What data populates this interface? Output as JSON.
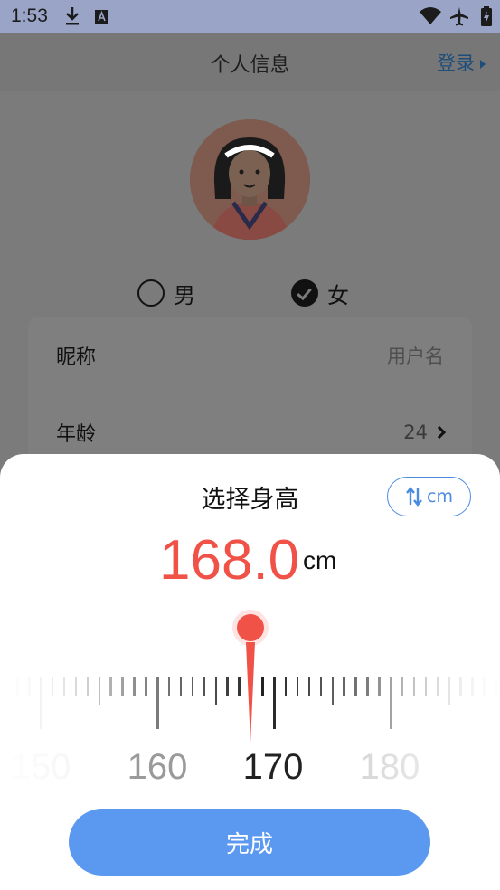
{
  "status_bar": {
    "time": "1:53"
  },
  "header": {
    "title": "个人信息",
    "login_label": "登录"
  },
  "gender": {
    "male_label": "男",
    "female_label": "女",
    "selected": "female"
  },
  "info": {
    "nickname_label": "昵称",
    "nickname_placeholder": "用户名",
    "age_label": "年龄",
    "age_value": "24"
  },
  "sheet": {
    "title": "选择身高",
    "unit_toggle_label": "cm",
    "height_value": "168.0",
    "height_unit": "cm",
    "ruler_labels": [
      "150",
      "160",
      "170",
      "180"
    ],
    "done_label": "完成"
  },
  "colors": {
    "accent_blue": "#5b98f0",
    "value_red": "#f05248"
  },
  "icons": [
    "download-icon",
    "font-icon",
    "wifi-icon",
    "airplane-icon",
    "battery-icon",
    "swap-icon"
  ]
}
